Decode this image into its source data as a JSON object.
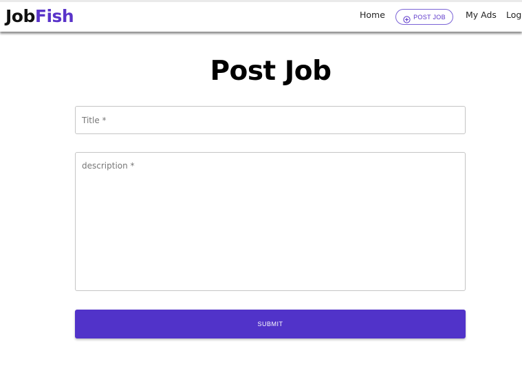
{
  "brand": {
    "part1": "Job",
    "part2": "Fish"
  },
  "nav": {
    "home": "Home",
    "post_job": "POST JOB",
    "my_ads": "My Ads",
    "logout": "Logo"
  },
  "page": {
    "title": "Post Job"
  },
  "form": {
    "title_placeholder": "Title *",
    "title_value": "",
    "description_placeholder": "description *",
    "description_value": "",
    "submit_label": "SUBMIT"
  },
  "colors": {
    "accent": "#5133c9",
    "brand_accent": "#5a34c9"
  },
  "icons": {
    "post_job": "plus-circle-icon"
  }
}
